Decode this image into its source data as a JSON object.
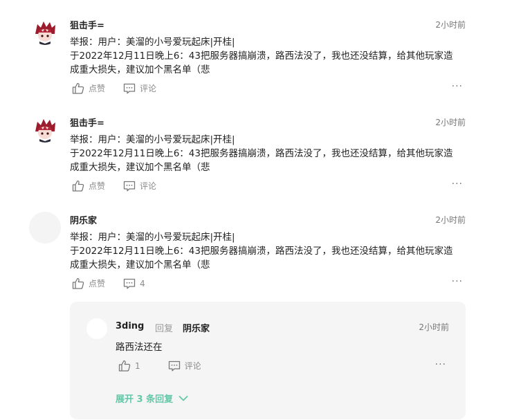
{
  "comments": [
    {
      "author": "狙击手=",
      "time": "2小时前",
      "line1": "举报：用户：美溜的小号爱玩起床|开桂|",
      "line2": "于2022年12月11日晚上6：43把服务器搞崩溃，路西法没了，我也还没结算，给其他玩家造",
      "line3": "成重大损失，建议加个黑名单（悲",
      "like_label": "点赞",
      "comment_label": "评论",
      "more": "···"
    },
    {
      "author": "狙击手=",
      "time": "2小时前",
      "line1": "举报：用户：美溜的小号爱玩起床|开桂|",
      "line2": "于2022年12月11日晚上6：43把服务器搞崩溃，路西法没了，我也还没结算，给其他玩家造",
      "line3": "成重大损失，建议加个黑名单（悲",
      "like_label": "点赞",
      "comment_label": "评论",
      "more": "···"
    },
    {
      "author": "阴乐家",
      "time": "2小时前",
      "line1": "举报：用户：美溜的小号爱玩起床|开桂|",
      "line2": "于2022年12月11日晚上6：43把服务器搞崩溃，路西法没了，我也还没结算，给其他玩家造",
      "line3": "成重大损失，建议加个黑名单（悲",
      "like_label": "点赞",
      "comment_label": "4",
      "more": "···"
    }
  ],
  "reply": {
    "author": "3ding",
    "reply_word": "回复",
    "target": "阴乐家",
    "time": "2小时前",
    "text": "路西法还在",
    "like_count": "1",
    "comment_label": "评论",
    "more": "···"
  },
  "expand_label": "展开 3 条回复",
  "colors": {
    "accent": "#63c8a8",
    "avatar_hair": "#9b1c2c"
  }
}
